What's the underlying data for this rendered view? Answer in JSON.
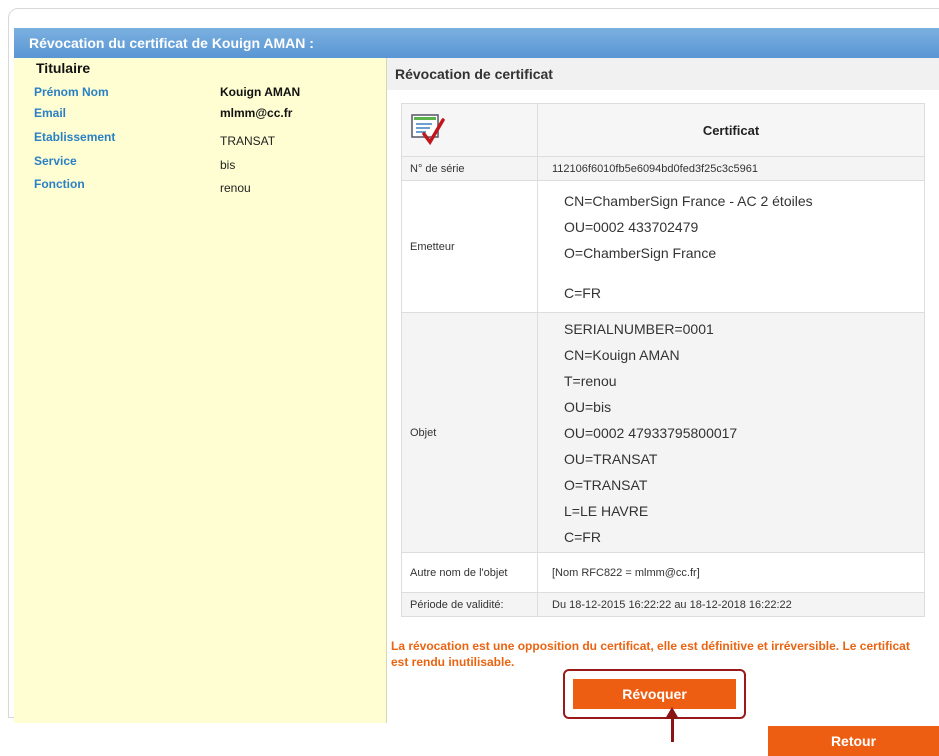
{
  "title": "Révocation du certificat de Kouign AMAN :",
  "titulaire": {
    "heading": "Titulaire",
    "rows": [
      {
        "label": "Prénom Nom",
        "value": "Kouign AMAN"
      },
      {
        "label": "Email",
        "value": "mlmm@cc.fr"
      },
      {
        "label": "Etablissement",
        "value": "TRANSAT"
      },
      {
        "label": "Service",
        "value": "bis"
      },
      {
        "label": "Fonction",
        "value": "renou"
      }
    ]
  },
  "revocation": {
    "heading": "Révocation de certificat",
    "cert_header": "Certificat",
    "cert_icon": "certificate-icon",
    "serial_label": "N° de série",
    "serial_value": "112106f6010fb5e6094bd0fed3f25c3c5961",
    "emetteur_label": "Emetteur",
    "emetteur_lines": [
      "CN=ChamberSign France - AC 2 étoiles",
      "OU=0002 433702479",
      "O=ChamberSign France",
      "",
      "C=FR"
    ],
    "objet_label": "Objet",
    "objet_lines": [
      "SERIALNUMBER=0001",
      "CN=Kouign AMAN",
      "T=renou",
      "OU=bis",
      "OU=0002 47933795800017",
      "OU=TRANSAT",
      "O=TRANSAT",
      "L=LE HAVRE",
      "C=FR"
    ],
    "autre_label": "Autre nom de l'objet",
    "autre_value": "[Nom RFC822 = mlmm@cc.fr]",
    "periode_label": "Période de validité:",
    "periode_value": "Du 18-12-2015 16:22:22 au 18-12-2018 16:22:22",
    "warning": "La révocation est une opposition du certificat, elle est définitive et irréversible. Le certificat est rendu inutilisable.",
    "revoquer_label": "Révoquer",
    "retour_label": "Retour"
  },
  "colors": {
    "accent": "#ee5e12",
    "title_bar": "#6aa3da",
    "label_blue": "#2a80c4",
    "left_panel": "#fffed2",
    "highlight": "#9a1a1a"
  }
}
